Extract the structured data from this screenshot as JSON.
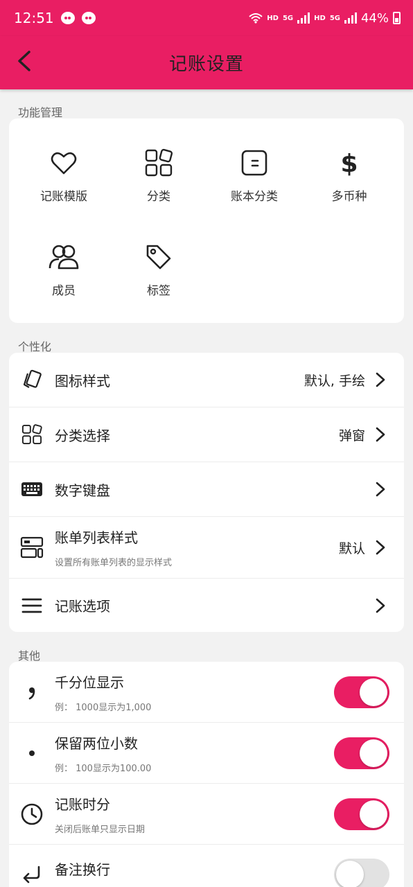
{
  "status_bar": {
    "time": "12:51",
    "hd1": "HD",
    "net1": "5G",
    "hd2": "HD",
    "net2": "5G",
    "battery": "44%"
  },
  "header": {
    "title": "记账设置"
  },
  "sections": {
    "function": "功能管理",
    "personal": "个性化",
    "other": "其他"
  },
  "function_items": [
    {
      "label": "记账模版",
      "icon": "heart-icon"
    },
    {
      "label": "分类",
      "icon": "category-grid-icon"
    },
    {
      "label": "账本分类",
      "icon": "book-category-icon"
    },
    {
      "label": "多币种",
      "icon": "dollar-icon"
    },
    {
      "label": "成员",
      "icon": "members-icon"
    },
    {
      "label": "标签",
      "icon": "tag-icon"
    }
  ],
  "personal_rows": [
    {
      "label": "图标样式",
      "value": "默认, 手绘",
      "icon": "card-style-icon"
    },
    {
      "label": "分类选择",
      "value": "弹窗",
      "icon": "category-grid-icon"
    },
    {
      "label": "数字键盘",
      "value": "",
      "icon": "keyboard-icon"
    },
    {
      "label": "账单列表样式",
      "sub": "设置所有账单列表的显示样式",
      "value": "默认",
      "icon": "list-layout-icon"
    },
    {
      "label": "记账选项",
      "value": "",
      "icon": "menu-icon"
    }
  ],
  "other_rows": [
    {
      "label": "千分位显示",
      "sub": "例： 1000显示为1,000",
      "on": true,
      "icon": "comma-icon"
    },
    {
      "label": "保留两位小数",
      "sub": "例： 100显示为100.00",
      "on": true,
      "icon": "dot-icon"
    },
    {
      "label": "记账时分",
      "sub": "关闭后账单只显示日期",
      "on": true,
      "icon": "clock-icon"
    },
    {
      "label": "备注换行",
      "sub": "",
      "on": false,
      "icon": "return-icon"
    }
  ],
  "colors": {
    "accent": "#e91e63",
    "background": "#f2f2f2"
  }
}
